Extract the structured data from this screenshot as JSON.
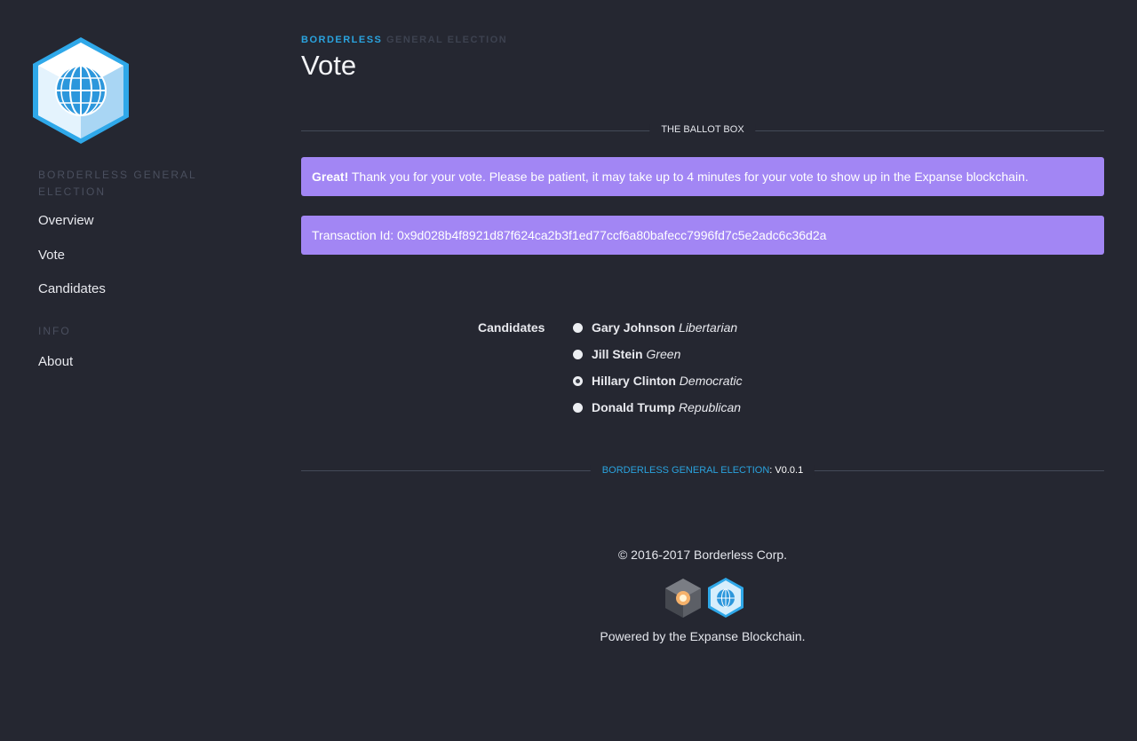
{
  "sidebar": {
    "sections": [
      {
        "heading": "BORDERLESS GENERAL ELECTION",
        "items": [
          {
            "label": "Overview"
          },
          {
            "label": "Vote"
          },
          {
            "label": "Candidates"
          }
        ]
      },
      {
        "heading": "INFO",
        "items": [
          {
            "label": "About"
          }
        ]
      }
    ]
  },
  "header": {
    "eyebrow_brand": "BORDERLESS",
    "eyebrow_rest": "GENERAL ELECTION",
    "title": "Vote"
  },
  "ballot": {
    "divider_label": "THE BALLOT BOX",
    "success_alert": {
      "strong": "Great!",
      "text": " Thank you for your vote. Please be patient, it may take up to 4 minutes for your vote to show up in the Expanse blockchain."
    },
    "transaction_alert": "Transaction Id: 0x9d028b4f8921d87f624ca2b3f1ed77ccf6a80bafecc7996fd7c5e2adc6c36d2a",
    "candidates_label": "Candidates",
    "candidates": [
      {
        "name": "Gary Johnson",
        "party": "Libertarian",
        "selected": false
      },
      {
        "name": "Jill Stein",
        "party": "Green",
        "selected": false
      },
      {
        "name": "Hillary Clinton",
        "party": "Democratic",
        "selected": true
      },
      {
        "name": "Donald Trump",
        "party": "Republican",
        "selected": false
      }
    ]
  },
  "footer": {
    "app_name": "BORDERLESS GENERAL ELECTION",
    "version": ": V0.0.1",
    "copyright": "© 2016-2017 Borderless Corp.",
    "powered_by": "Powered by the Expanse Blockchain."
  },
  "colors": {
    "background": "#252731",
    "accent": "#2aa3de",
    "alert": "#a286f4"
  },
  "icons": {
    "logo": "cube-globe-logo-icon",
    "expanse": "expanse-logo-icon",
    "borderless": "borderless-logo-icon"
  }
}
